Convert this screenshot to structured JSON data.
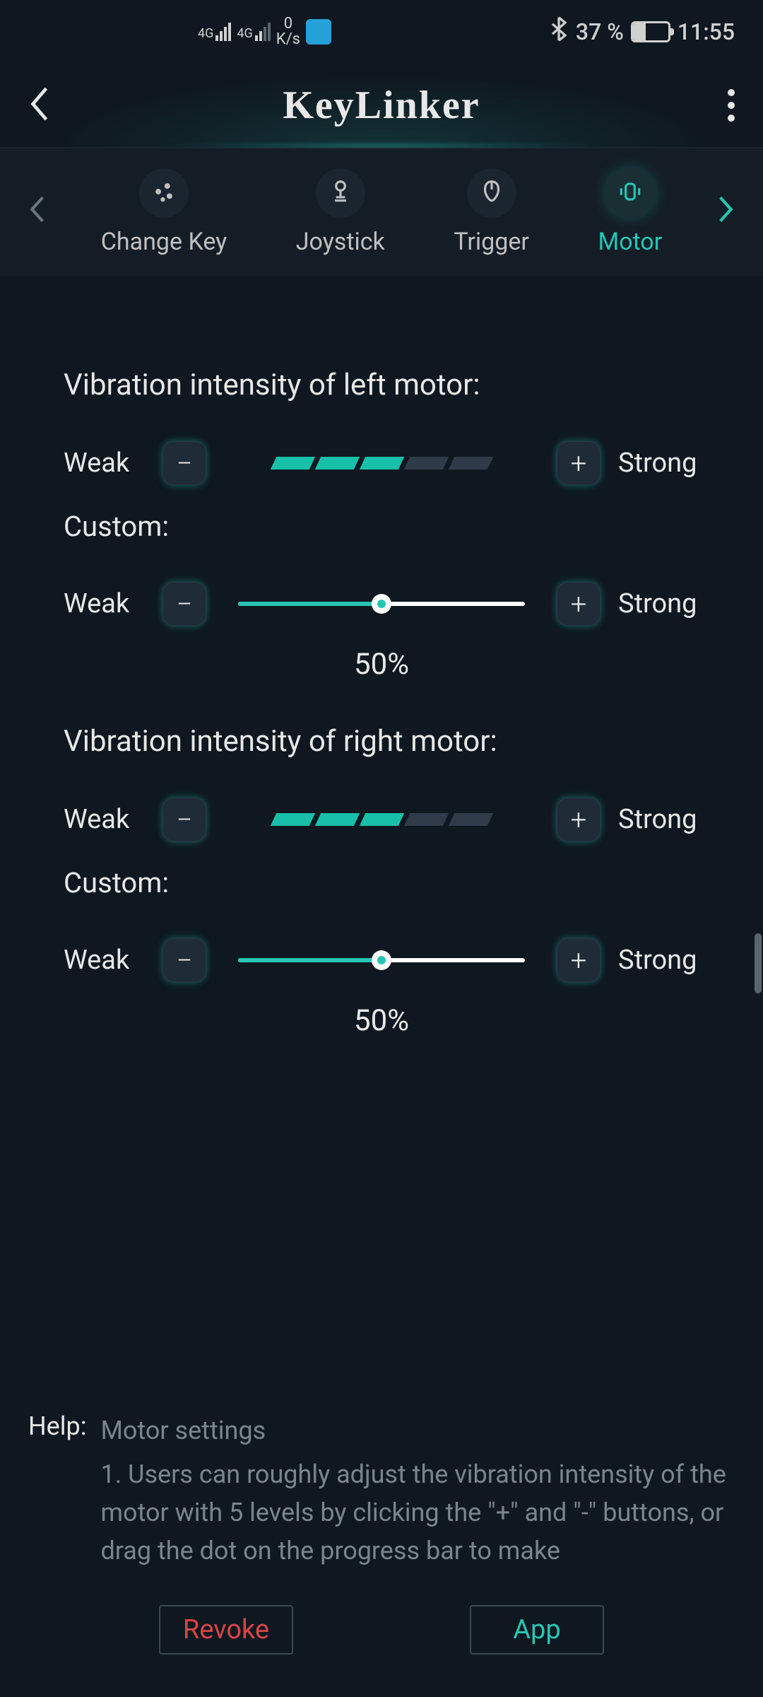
{
  "status_bar": {
    "sig1_label": "4G",
    "sig2_label": "4G",
    "data_value": "0",
    "data_unit": "K/s",
    "battery_pct": "37 %",
    "time": "11:55"
  },
  "header": {
    "title": "KeyLinker"
  },
  "tabs": {
    "items": [
      {
        "label": "Change Key"
      },
      {
        "label": "Joystick"
      },
      {
        "label": "Trigger"
      },
      {
        "label": "Motor"
      }
    ]
  },
  "motor": {
    "left": {
      "title": "Vibration intensity of left motor:",
      "weak": "Weak",
      "strong": "Strong",
      "level": 3,
      "custom_label": "Custom:",
      "slider_pct": 50,
      "slider_text": "50%"
    },
    "right": {
      "title": "Vibration intensity of right motor:",
      "weak": "Weak",
      "strong": "Strong",
      "level": 3,
      "custom_label": "Custom:",
      "slider_pct": 50,
      "slider_text": "50%"
    }
  },
  "help": {
    "label": "Help:",
    "title": "Motor settings",
    "body": "1. Users can roughly adjust the vibration intensity of the motor with 5 levels by clicking the \"+\" and \"-\" buttons, or drag the dot on the progress bar to make"
  },
  "buttons": {
    "revoke": "Revoke",
    "app": "App"
  }
}
